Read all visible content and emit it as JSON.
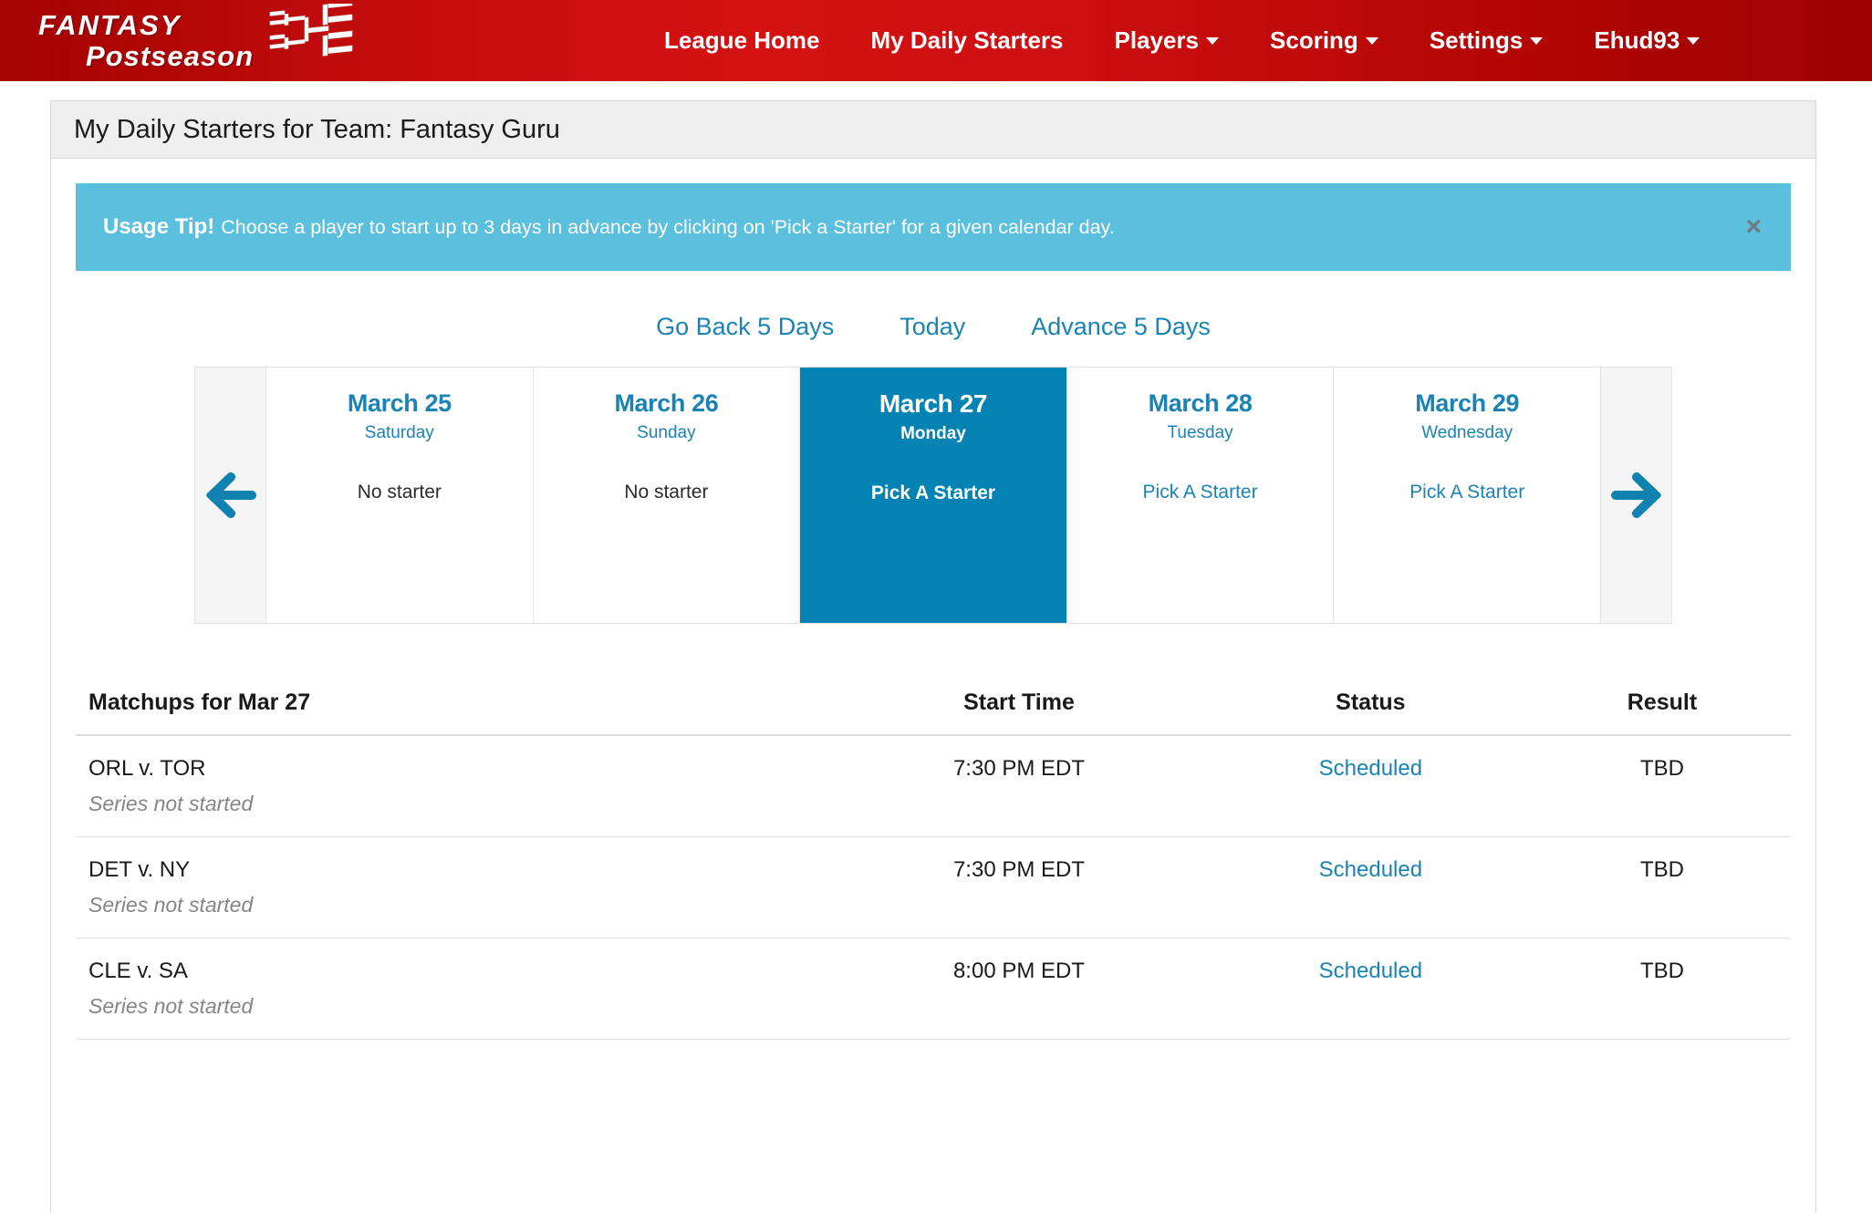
{
  "navbar": {
    "brand": {
      "line1": "FANTASY",
      "line2": "Postseason",
      "icon": "bracket-logo"
    },
    "items": [
      {
        "label": "League Home",
        "caret": false
      },
      {
        "label": "My Daily Starters",
        "caret": false
      },
      {
        "label": "Players",
        "caret": true
      },
      {
        "label": "Scoring",
        "caret": true
      },
      {
        "label": "Settings",
        "caret": true
      },
      {
        "label": "Ehud93",
        "caret": true
      }
    ],
    "background_color": "#c00b0b"
  },
  "panel": {
    "title": "My Daily Starters for Team: Fantasy Guru"
  },
  "alert": {
    "strong": "Usage Tip!",
    "text": "Choose a player to start up to 3 days in advance by clicking on 'Pick a Starter' for a given calendar day.",
    "close_label": "×",
    "background_color": "#5bc0de"
  },
  "date_nav": {
    "back": "Go Back 5 Days",
    "today": "Today",
    "advance": "Advance 5 Days"
  },
  "calendar": {
    "prev_icon": "arrow-left-icon",
    "next_icon": "arrow-right-icon",
    "accent_color": "#0283b4",
    "days": [
      {
        "date": "March 25",
        "dow": "Saturday",
        "status": "No starter",
        "status_is_link": false,
        "selected": false
      },
      {
        "date": "March 26",
        "dow": "Sunday",
        "status": "No starter",
        "status_is_link": false,
        "selected": false
      },
      {
        "date": "March 27",
        "dow": "Monday",
        "status": "Pick A Starter",
        "status_is_link": true,
        "selected": true
      },
      {
        "date": "March 28",
        "dow": "Tuesday",
        "status": "Pick A Starter",
        "status_is_link": true,
        "selected": false
      },
      {
        "date": "March 29",
        "dow": "Wednesday",
        "status": "Pick A Starter",
        "status_is_link": true,
        "selected": false
      }
    ]
  },
  "matchups_table": {
    "headers": {
      "matchups": "Matchups for Mar 27",
      "start_time": "Start Time",
      "status": "Status",
      "result": "Result"
    },
    "rows": [
      {
        "matchup": "ORL v. TOR",
        "note": "Series not started",
        "start_time": "7:30 PM EDT",
        "status": "Scheduled",
        "result": "TBD"
      },
      {
        "matchup": "DET v. NY",
        "note": "Series not started",
        "start_time": "7:30 PM EDT",
        "status": "Scheduled",
        "result": "TBD"
      },
      {
        "matchup": "CLE v. SA",
        "note": "Series not started",
        "start_time": "8:00 PM EDT",
        "status": "Scheduled",
        "result": "TBD"
      }
    ]
  }
}
